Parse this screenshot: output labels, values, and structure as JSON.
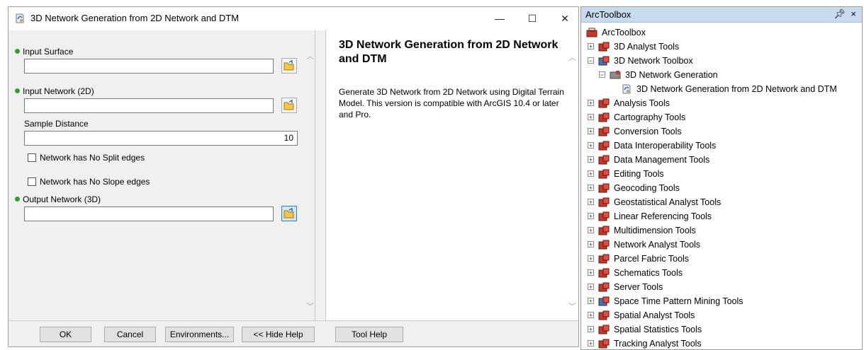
{
  "dialog": {
    "title": "3D Network Generation from 2D Network and DTM",
    "window_buttons": {
      "minimize": "—",
      "maximize": "☐",
      "close": "✕"
    },
    "params": {
      "input_surface_label": "Input Surface",
      "input_surface_value": "",
      "input_network_label": "Input Network (2D)",
      "input_network_value": "",
      "sample_distance_label": "Sample Distance",
      "sample_distance_value": "10",
      "no_split_label": "Network has No Split edges",
      "no_slope_label": "Network has No Slope edges",
      "output_network_label": "Output Network (3D)",
      "output_network_value": ""
    },
    "help": {
      "title": "3D Network Generation from 2D Network and DTM",
      "description": "Generate 3D Network from 2D Network using Digital Terrain Model. This version is compatible with ArcGIS 10.4 or later and Pro."
    },
    "buttons": {
      "ok": "OK",
      "cancel": "Cancel",
      "environments": "Environments...",
      "hide_help": "<< Hide Help",
      "tool_help": "Tool Help"
    },
    "colors": {
      "required_dot": "#2fa02f",
      "accent": "#3c7fb1"
    }
  },
  "toolbox": {
    "title": "ArcToolbox",
    "pin": "ᵖ",
    "close": "×",
    "root": "ArcToolbox",
    "items": [
      {
        "label": "3D Analyst Tools",
        "expander": "+"
      },
      {
        "label": "3D Network Toolbox",
        "expander": "−"
      },
      {
        "label": "3D Network Generation",
        "expander": "−"
      },
      {
        "label": "3D Network Generation from 2D Network and DTM",
        "expander": ""
      },
      {
        "label": "Analysis Tools",
        "expander": "+"
      },
      {
        "label": "Cartography Tools",
        "expander": "+"
      },
      {
        "label": "Conversion Tools",
        "expander": "+"
      },
      {
        "label": "Data Interoperability Tools",
        "expander": "+"
      },
      {
        "label": "Data Management Tools",
        "expander": "+"
      },
      {
        "label": "Editing Tools",
        "expander": "+"
      },
      {
        "label": "Geocoding Tools",
        "expander": "+"
      },
      {
        "label": "Geostatistical Analyst Tools",
        "expander": "+"
      },
      {
        "label": "Linear Referencing Tools",
        "expander": "+"
      },
      {
        "label": "Multidimension Tools",
        "expander": "+"
      },
      {
        "label": "Network Analyst Tools",
        "expander": "+"
      },
      {
        "label": "Parcel Fabric Tools",
        "expander": "+"
      },
      {
        "label": "Schematics Tools",
        "expander": "+"
      },
      {
        "label": "Server Tools",
        "expander": "+"
      },
      {
        "label": "Space Time Pattern Mining Tools",
        "expander": "+"
      },
      {
        "label": "Spatial Analyst Tools",
        "expander": "+"
      },
      {
        "label": "Spatial Statistics Tools",
        "expander": "+"
      },
      {
        "label": "Tracking Analyst Tools",
        "expander": "+"
      }
    ]
  }
}
